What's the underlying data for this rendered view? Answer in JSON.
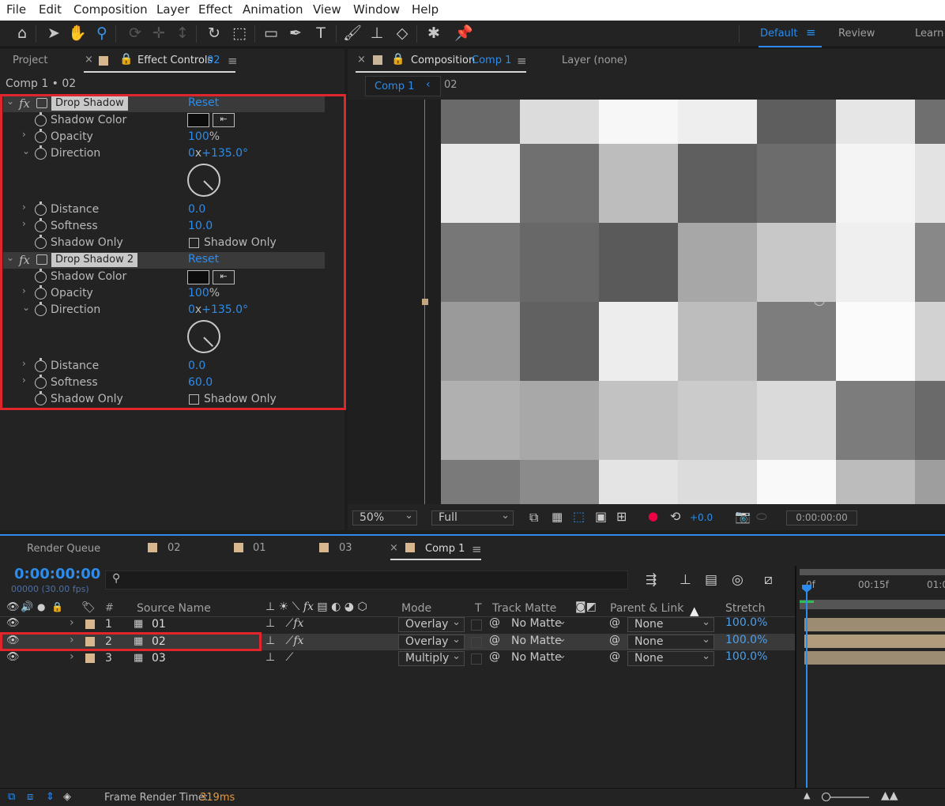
{
  "menu": [
    "File",
    "Edit",
    "Composition",
    "Layer",
    "Effect",
    "Animation",
    "View",
    "Window",
    "Help"
  ],
  "workspace": {
    "active": "Default",
    "items": [
      "Review",
      "Learn"
    ]
  },
  "left_panel": {
    "tab_project": "Project",
    "tab_effect": "Effect Controls",
    "tab_effect_layer": "02",
    "breadcrumb": "Comp 1 • 02",
    "effects": [
      {
        "name": "Drop Shadow",
        "reset": "Reset",
        "shadow_color": "Shadow Color",
        "opacity_label": "Opacity",
        "opacity_value": "100",
        "opacity_unit": "%",
        "direction_label": "Direction",
        "direction_rev": "0",
        "direction_x": "x",
        "direction_deg": "+135.0°",
        "distance_label": "Distance",
        "distance_value": "0.0",
        "softness_label": "Softness",
        "softness_value": "10.0",
        "shadow_only_label": "Shadow Only",
        "shadow_only_cb": "Shadow Only"
      },
      {
        "name": "Drop Shadow 2",
        "reset": "Reset",
        "shadow_color": "Shadow Color",
        "opacity_label": "Opacity",
        "opacity_value": "100",
        "opacity_unit": "%",
        "direction_label": "Direction",
        "direction_rev": "0",
        "direction_x": "x",
        "direction_deg": "+135.0°",
        "distance_label": "Distance",
        "distance_value": "0.0",
        "softness_label": "Softness",
        "softness_value": "60.0",
        "shadow_only_label": "Shadow Only",
        "shadow_only_cb": "Shadow Only"
      }
    ]
  },
  "comp_panel": {
    "tab_label": "Composition",
    "tab_comp": "Comp 1",
    "layer_tab": "Layer (none)",
    "crumb_comp": "Comp 1",
    "crumb_layer": "02",
    "zoom": "50%",
    "resolution": "Full",
    "exposure": "+0.0",
    "timecode": "0:00:00:00"
  },
  "timeline": {
    "tabs": [
      "Render Queue",
      "02",
      "01",
      "03",
      "Comp 1"
    ],
    "timecode": "0:00:00:00",
    "frames": "00000 (30.00 fps)",
    "search_placeholder": "",
    "col_num": "#",
    "col_source": "Source Name",
    "col_mode": "Mode",
    "col_t": "T",
    "col_matte": "Track Matte",
    "col_parent": "Parent & Link",
    "col_stretch": "Stretch",
    "ruler": [
      "0f",
      "00:15f",
      "01:0"
    ],
    "layers": [
      {
        "num": "1",
        "name": "01",
        "mode": "Overlay",
        "matte": "No Matte",
        "parent": "None",
        "stretch": "100.0%"
      },
      {
        "num": "2",
        "name": "02",
        "mode": "Overlay",
        "matte": "No Matte",
        "parent": "None",
        "stretch": "100.0%"
      },
      {
        "num": "3",
        "name": "03",
        "mode": "Multiply",
        "matte": "No Matte",
        "parent": "None",
        "stretch": "100.0%"
      }
    ],
    "status_label": "Frame Render Time:",
    "status_value": "319ms"
  },
  "colors": {
    "accent": "#2d8ceb",
    "highlight_red": "#e0252b",
    "layer_label": "#d8b78e"
  }
}
